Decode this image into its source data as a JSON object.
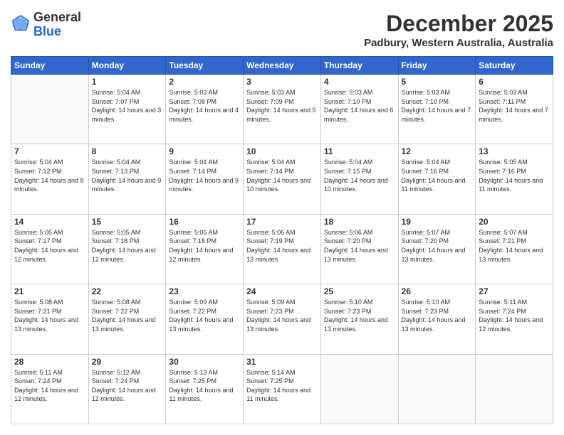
{
  "header": {
    "logo_line1": "General",
    "logo_line2": "Blue",
    "month_title": "December 2025",
    "location": "Padbury, Western Australia, Australia"
  },
  "days_of_week": [
    "Sunday",
    "Monday",
    "Tuesday",
    "Wednesday",
    "Thursday",
    "Friday",
    "Saturday"
  ],
  "weeks": [
    [
      {
        "day": "",
        "sunrise": "",
        "sunset": "",
        "daylight": "",
        "empty": true
      },
      {
        "day": "1",
        "sunrise": "5:04 AM",
        "sunset": "7:07 PM",
        "daylight": "14 hours and 3 minutes."
      },
      {
        "day": "2",
        "sunrise": "5:03 AM",
        "sunset": "7:08 PM",
        "daylight": "14 hours and 4 minutes."
      },
      {
        "day": "3",
        "sunrise": "5:03 AM",
        "sunset": "7:09 PM",
        "daylight": "14 hours and 5 minutes."
      },
      {
        "day": "4",
        "sunrise": "5:03 AM",
        "sunset": "7:10 PM",
        "daylight": "14 hours and 6 minutes."
      },
      {
        "day": "5",
        "sunrise": "5:03 AM",
        "sunset": "7:10 PM",
        "daylight": "14 hours and 7 minutes."
      },
      {
        "day": "6",
        "sunrise": "5:03 AM",
        "sunset": "7:11 PM",
        "daylight": "14 hours and 7 minutes."
      }
    ],
    [
      {
        "day": "7",
        "sunrise": "5:04 AM",
        "sunset": "7:12 PM",
        "daylight": "14 hours and 8 minutes."
      },
      {
        "day": "8",
        "sunrise": "5:04 AM",
        "sunset": "7:13 PM",
        "daylight": "14 hours and 9 minutes."
      },
      {
        "day": "9",
        "sunrise": "5:04 AM",
        "sunset": "7:14 PM",
        "daylight": "14 hours and 9 minutes."
      },
      {
        "day": "10",
        "sunrise": "5:04 AM",
        "sunset": "7:14 PM",
        "daylight": "14 hours and 10 minutes."
      },
      {
        "day": "11",
        "sunrise": "5:04 AM",
        "sunset": "7:15 PM",
        "daylight": "14 hours and 10 minutes."
      },
      {
        "day": "12",
        "sunrise": "5:04 AM",
        "sunset": "7:16 PM",
        "daylight": "14 hours and 11 minutes."
      },
      {
        "day": "13",
        "sunrise": "5:05 AM",
        "sunset": "7:16 PM",
        "daylight": "14 hours and 11 minutes."
      }
    ],
    [
      {
        "day": "14",
        "sunrise": "5:05 AM",
        "sunset": "7:17 PM",
        "daylight": "14 hours and 12 minutes."
      },
      {
        "day": "15",
        "sunrise": "5:05 AM",
        "sunset": "7:18 PM",
        "daylight": "14 hours and 12 minutes."
      },
      {
        "day": "16",
        "sunrise": "5:05 AM",
        "sunset": "7:18 PM",
        "daylight": "14 hours and 12 minutes."
      },
      {
        "day": "17",
        "sunrise": "5:06 AM",
        "sunset": "7:19 PM",
        "daylight": "14 hours and 13 minutes."
      },
      {
        "day": "18",
        "sunrise": "5:06 AM",
        "sunset": "7:20 PM",
        "daylight": "14 hours and 13 minutes."
      },
      {
        "day": "19",
        "sunrise": "5:07 AM",
        "sunset": "7:20 PM",
        "daylight": "14 hours and 13 minutes."
      },
      {
        "day": "20",
        "sunrise": "5:07 AM",
        "sunset": "7:21 PM",
        "daylight": "14 hours and 13 minutes."
      }
    ],
    [
      {
        "day": "21",
        "sunrise": "5:08 AM",
        "sunset": "7:21 PM",
        "daylight": "14 hours and 13 minutes."
      },
      {
        "day": "22",
        "sunrise": "5:08 AM",
        "sunset": "7:22 PM",
        "daylight": "14 hours and 13 minutes."
      },
      {
        "day": "23",
        "sunrise": "5:09 AM",
        "sunset": "7:22 PM",
        "daylight": "14 hours and 13 minutes."
      },
      {
        "day": "24",
        "sunrise": "5:09 AM",
        "sunset": "7:23 PM",
        "daylight": "14 hours and 13 minutes."
      },
      {
        "day": "25",
        "sunrise": "5:10 AM",
        "sunset": "7:23 PM",
        "daylight": "14 hours and 13 minutes."
      },
      {
        "day": "26",
        "sunrise": "5:10 AM",
        "sunset": "7:23 PM",
        "daylight": "14 hours and 13 minutes."
      },
      {
        "day": "27",
        "sunrise": "5:11 AM",
        "sunset": "7:24 PM",
        "daylight": "14 hours and 12 minutes."
      }
    ],
    [
      {
        "day": "28",
        "sunrise": "5:11 AM",
        "sunset": "7:24 PM",
        "daylight": "14 hours and 12 minutes."
      },
      {
        "day": "29",
        "sunrise": "5:12 AM",
        "sunset": "7:24 PM",
        "daylight": "14 hours and 12 minutes."
      },
      {
        "day": "30",
        "sunrise": "5:13 AM",
        "sunset": "7:25 PM",
        "daylight": "14 hours and 11 minutes."
      },
      {
        "day": "31",
        "sunrise": "5:14 AM",
        "sunset": "7:25 PM",
        "daylight": "14 hours and 11 minutes."
      },
      {
        "day": "",
        "sunrise": "",
        "sunset": "",
        "daylight": "",
        "empty": true
      },
      {
        "day": "",
        "sunrise": "",
        "sunset": "",
        "daylight": "",
        "empty": true
      },
      {
        "day": "",
        "sunrise": "",
        "sunset": "",
        "daylight": "",
        "empty": true
      }
    ]
  ]
}
